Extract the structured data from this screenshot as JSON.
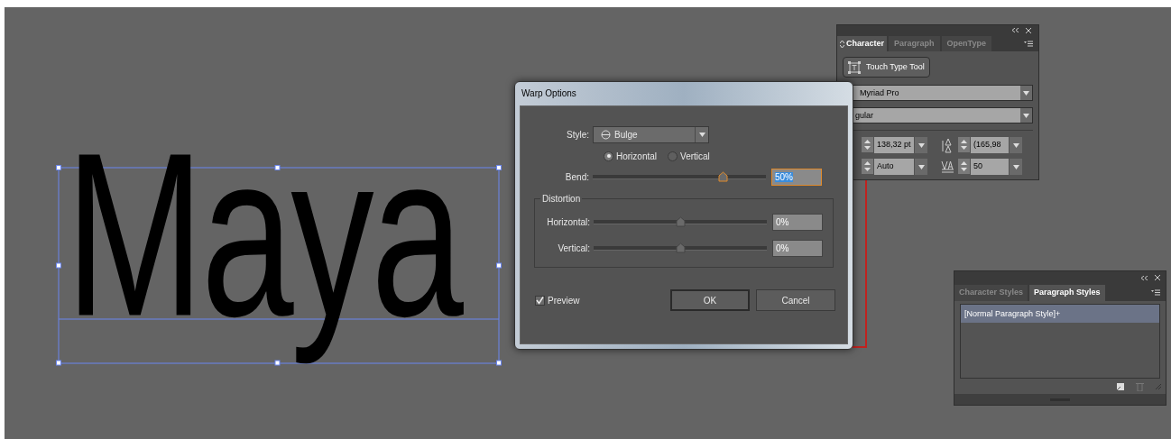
{
  "artboard": {
    "text": "Maya"
  },
  "warp_dialog": {
    "title": "Warp Options",
    "style_label": "Style:",
    "style_value": "Bulge",
    "orientation": [
      {
        "label": "Horizontal",
        "selected": true
      },
      {
        "label": "Vertical",
        "selected": false
      }
    ],
    "bend": {
      "label": "Bend:",
      "level": 0.75,
      "value": "50%"
    },
    "distortion": {
      "title": "Distortion",
      "sliders": [
        {
          "label": "Horizontal:",
          "level": 0.5,
          "value": "0%"
        },
        {
          "label": "Vertical:",
          "level": 0.5,
          "value": "0%"
        }
      ]
    },
    "preview": {
      "label": "Preview",
      "checked": true
    },
    "buttons": [
      "OK",
      "Cancel"
    ]
  },
  "character_panel": {
    "tabs": [
      {
        "label": "Character",
        "selected": true
      },
      {
        "label": "Paragraph",
        "selected": false
      },
      {
        "label": "OpenType",
        "selected": false
      }
    ],
    "touch_type_button": "Touch Type Tool",
    "font_family": "Myriad Pro",
    "font_style": "gular",
    "font_size": "138,32 pt",
    "leading": "(165,98",
    "kerning": "Auto",
    "tracking": "50"
  },
  "styles_panel": {
    "tabs": [
      {
        "label": "Character Styles",
        "selected": false
      },
      {
        "label": "Paragraph Styles",
        "selected": true
      }
    ],
    "items": [
      {
        "label": "[Normal Paragraph Style]+",
        "selected": true
      }
    ]
  }
}
